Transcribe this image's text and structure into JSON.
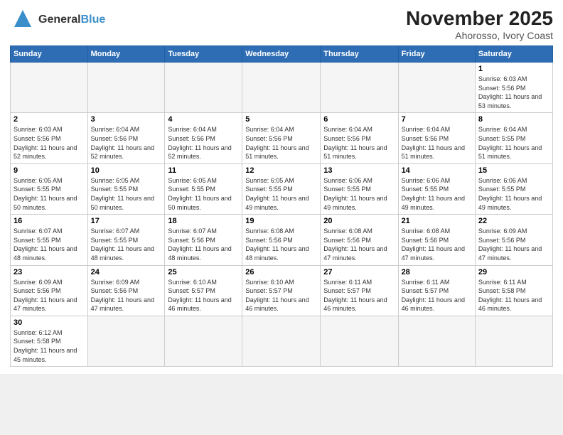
{
  "logo": {
    "text_general": "General",
    "text_blue": "Blue"
  },
  "header": {
    "month": "November 2025",
    "location": "Ahorosso, Ivory Coast"
  },
  "weekdays": [
    "Sunday",
    "Monday",
    "Tuesday",
    "Wednesday",
    "Thursday",
    "Friday",
    "Saturday"
  ],
  "weeks": [
    [
      {
        "day": "",
        "empty": true
      },
      {
        "day": "",
        "empty": true
      },
      {
        "day": "",
        "empty": true
      },
      {
        "day": "",
        "empty": true
      },
      {
        "day": "",
        "empty": true
      },
      {
        "day": "",
        "empty": true
      },
      {
        "day": "1",
        "sunrise": "6:03 AM",
        "sunset": "5:56 PM",
        "daylight": "11 hours and 53 minutes."
      }
    ],
    [
      {
        "day": "2",
        "sunrise": "6:03 AM",
        "sunset": "5:56 PM",
        "daylight": "11 hours and 52 minutes."
      },
      {
        "day": "3",
        "sunrise": "6:04 AM",
        "sunset": "5:56 PM",
        "daylight": "11 hours and 52 minutes."
      },
      {
        "day": "4",
        "sunrise": "6:04 AM",
        "sunset": "5:56 PM",
        "daylight": "11 hours and 52 minutes."
      },
      {
        "day": "5",
        "sunrise": "6:04 AM",
        "sunset": "5:56 PM",
        "daylight": "11 hours and 51 minutes."
      },
      {
        "day": "6",
        "sunrise": "6:04 AM",
        "sunset": "5:56 PM",
        "daylight": "11 hours and 51 minutes."
      },
      {
        "day": "7",
        "sunrise": "6:04 AM",
        "sunset": "5:56 PM",
        "daylight": "11 hours and 51 minutes."
      },
      {
        "day": "8",
        "sunrise": "6:04 AM",
        "sunset": "5:55 PM",
        "daylight": "11 hours and 51 minutes."
      }
    ],
    [
      {
        "day": "9",
        "sunrise": "6:05 AM",
        "sunset": "5:55 PM",
        "daylight": "11 hours and 50 minutes."
      },
      {
        "day": "10",
        "sunrise": "6:05 AM",
        "sunset": "5:55 PM",
        "daylight": "11 hours and 50 minutes."
      },
      {
        "day": "11",
        "sunrise": "6:05 AM",
        "sunset": "5:55 PM",
        "daylight": "11 hours and 50 minutes."
      },
      {
        "day": "12",
        "sunrise": "6:05 AM",
        "sunset": "5:55 PM",
        "daylight": "11 hours and 49 minutes."
      },
      {
        "day": "13",
        "sunrise": "6:06 AM",
        "sunset": "5:55 PM",
        "daylight": "11 hours and 49 minutes."
      },
      {
        "day": "14",
        "sunrise": "6:06 AM",
        "sunset": "5:55 PM",
        "daylight": "11 hours and 49 minutes."
      },
      {
        "day": "15",
        "sunrise": "6:06 AM",
        "sunset": "5:55 PM",
        "daylight": "11 hours and 49 minutes."
      }
    ],
    [
      {
        "day": "16",
        "sunrise": "6:07 AM",
        "sunset": "5:55 PM",
        "daylight": "11 hours and 48 minutes."
      },
      {
        "day": "17",
        "sunrise": "6:07 AM",
        "sunset": "5:55 PM",
        "daylight": "11 hours and 48 minutes."
      },
      {
        "day": "18",
        "sunrise": "6:07 AM",
        "sunset": "5:56 PM",
        "daylight": "11 hours and 48 minutes."
      },
      {
        "day": "19",
        "sunrise": "6:08 AM",
        "sunset": "5:56 PM",
        "daylight": "11 hours and 48 minutes."
      },
      {
        "day": "20",
        "sunrise": "6:08 AM",
        "sunset": "5:56 PM",
        "daylight": "11 hours and 47 minutes."
      },
      {
        "day": "21",
        "sunrise": "6:08 AM",
        "sunset": "5:56 PM",
        "daylight": "11 hours and 47 minutes."
      },
      {
        "day": "22",
        "sunrise": "6:09 AM",
        "sunset": "5:56 PM",
        "daylight": "11 hours and 47 minutes."
      }
    ],
    [
      {
        "day": "23",
        "sunrise": "6:09 AM",
        "sunset": "5:56 PM",
        "daylight": "11 hours and 47 minutes."
      },
      {
        "day": "24",
        "sunrise": "6:09 AM",
        "sunset": "5:56 PM",
        "daylight": "11 hours and 47 minutes."
      },
      {
        "day": "25",
        "sunrise": "6:10 AM",
        "sunset": "5:57 PM",
        "daylight": "11 hours and 46 minutes."
      },
      {
        "day": "26",
        "sunrise": "6:10 AM",
        "sunset": "5:57 PM",
        "daylight": "11 hours and 46 minutes."
      },
      {
        "day": "27",
        "sunrise": "6:11 AM",
        "sunset": "5:57 PM",
        "daylight": "11 hours and 46 minutes."
      },
      {
        "day": "28",
        "sunrise": "6:11 AM",
        "sunset": "5:57 PM",
        "daylight": "11 hours and 46 minutes."
      },
      {
        "day": "29",
        "sunrise": "6:11 AM",
        "sunset": "5:58 PM",
        "daylight": "11 hours and 46 minutes."
      }
    ],
    [
      {
        "day": "30",
        "sunrise": "6:12 AM",
        "sunset": "5:58 PM",
        "daylight": "11 hours and 45 minutes."
      },
      {
        "day": "",
        "empty": true
      },
      {
        "day": "",
        "empty": true
      },
      {
        "day": "",
        "empty": true
      },
      {
        "day": "",
        "empty": true
      },
      {
        "day": "",
        "empty": true
      },
      {
        "day": "",
        "empty": true
      }
    ]
  ],
  "labels": {
    "sunrise": "Sunrise:",
    "sunset": "Sunset:",
    "daylight": "Daylight:"
  }
}
